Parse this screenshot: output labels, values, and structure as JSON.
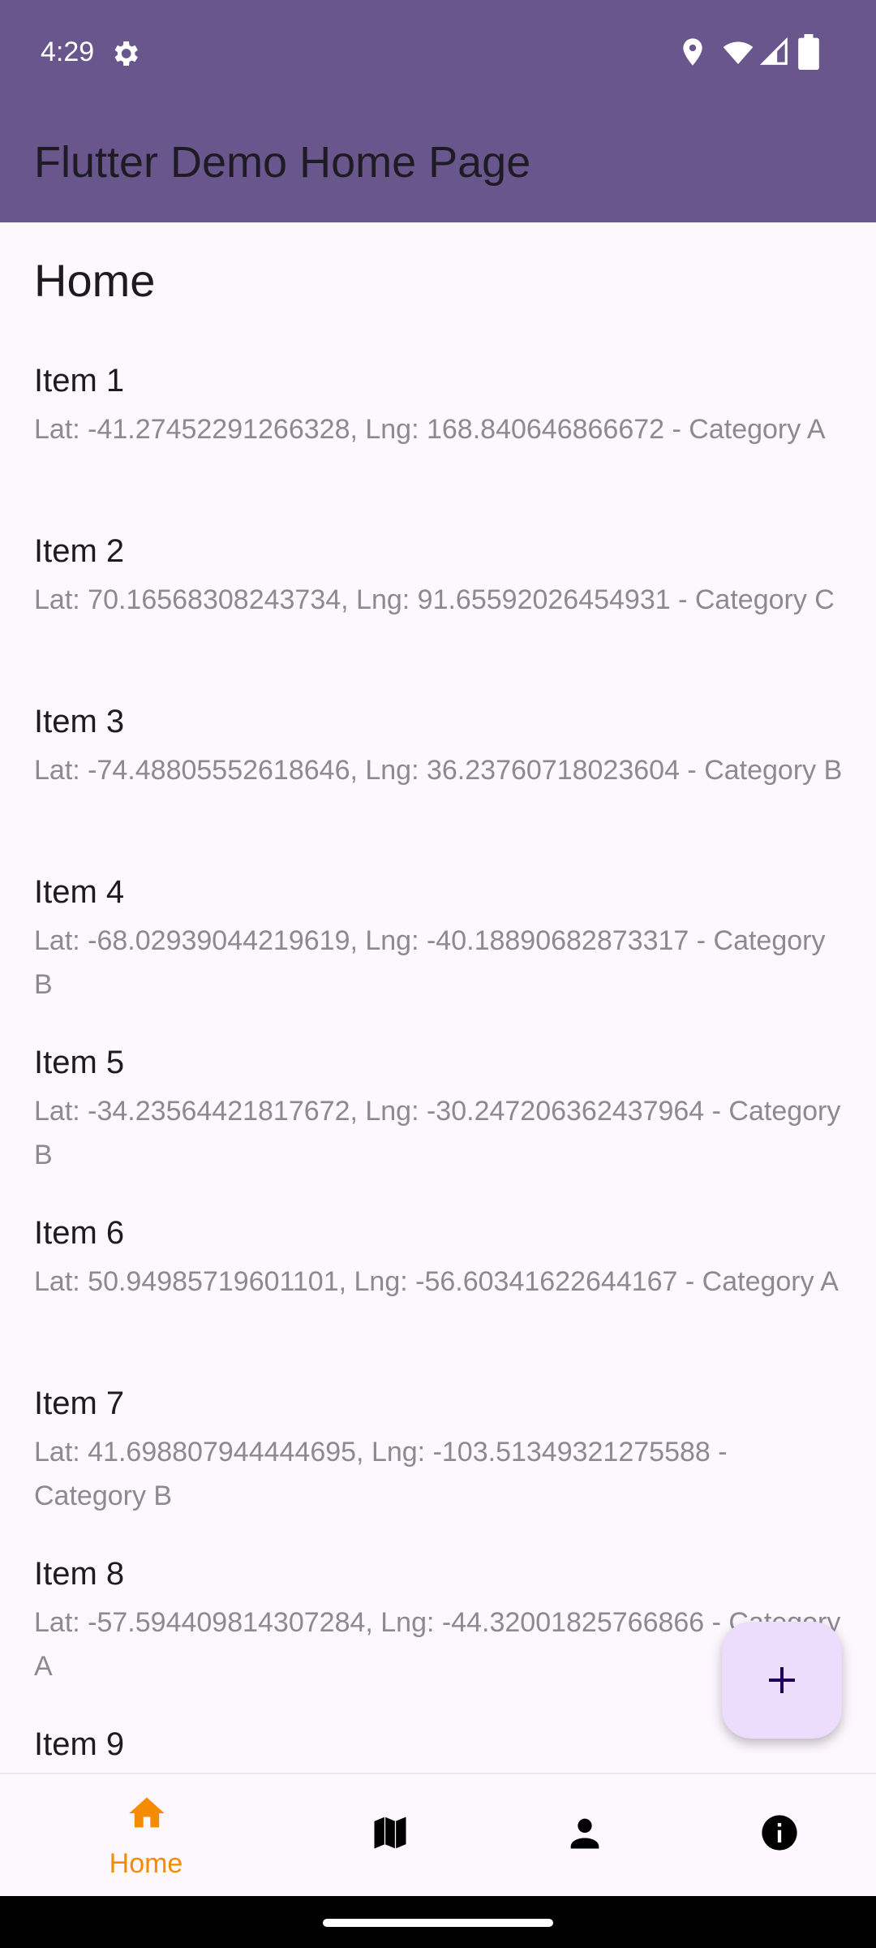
{
  "status_bar": {
    "time": "4:29",
    "icons": [
      "settings-icon",
      "location-icon",
      "wifi-icon",
      "signal-icon",
      "battery-icon"
    ]
  },
  "app_bar": {
    "title": "Flutter Demo Home Page",
    "color": "#68568C"
  },
  "main": {
    "section_title": "Home",
    "items": [
      {
        "title": "Item 1",
        "subtitle": "Lat: -41.27452291266328, Lng: 168.840646866672 - Category A"
      },
      {
        "title": "Item 2",
        "subtitle": "Lat: 70.16568308243734, Lng: 91.65592026454931 - Category C"
      },
      {
        "title": "Item 3",
        "subtitle": "Lat: -74.48805552618646, Lng: 36.23760718023604 - Category B"
      },
      {
        "title": "Item 4",
        "subtitle": "Lat: -68.02939044219619, Lng: -40.18890682873317 - Category B"
      },
      {
        "title": "Item 5",
        "subtitle": "Lat: -34.23564421817672, Lng: -30.247206362437964 - Category B"
      },
      {
        "title": "Item 6",
        "subtitle": "Lat: 50.94985719601101, Lng: -56.60341622644167 - Category A"
      },
      {
        "title": "Item 7",
        "subtitle": "Lat: 41.698807944444695, Lng: -103.51349321275588 - Category B"
      },
      {
        "title": "Item 8",
        "subtitle": "Lat: -57.594409814307284, Lng: -44.32001825766866 - Category A"
      },
      {
        "title": "Item 9",
        "subtitle": ""
      }
    ]
  },
  "fab": {
    "icon": "plus-icon",
    "background": "#EBDDFB"
  },
  "bottom_nav": {
    "active_color": "#F48B00",
    "items": [
      {
        "label": "Home",
        "icon": "home-icon",
        "active": true
      },
      {
        "label": "",
        "icon": "map-icon",
        "active": false
      },
      {
        "label": "",
        "icon": "person-icon",
        "active": false
      },
      {
        "label": "",
        "icon": "info-icon",
        "active": false
      }
    ]
  }
}
